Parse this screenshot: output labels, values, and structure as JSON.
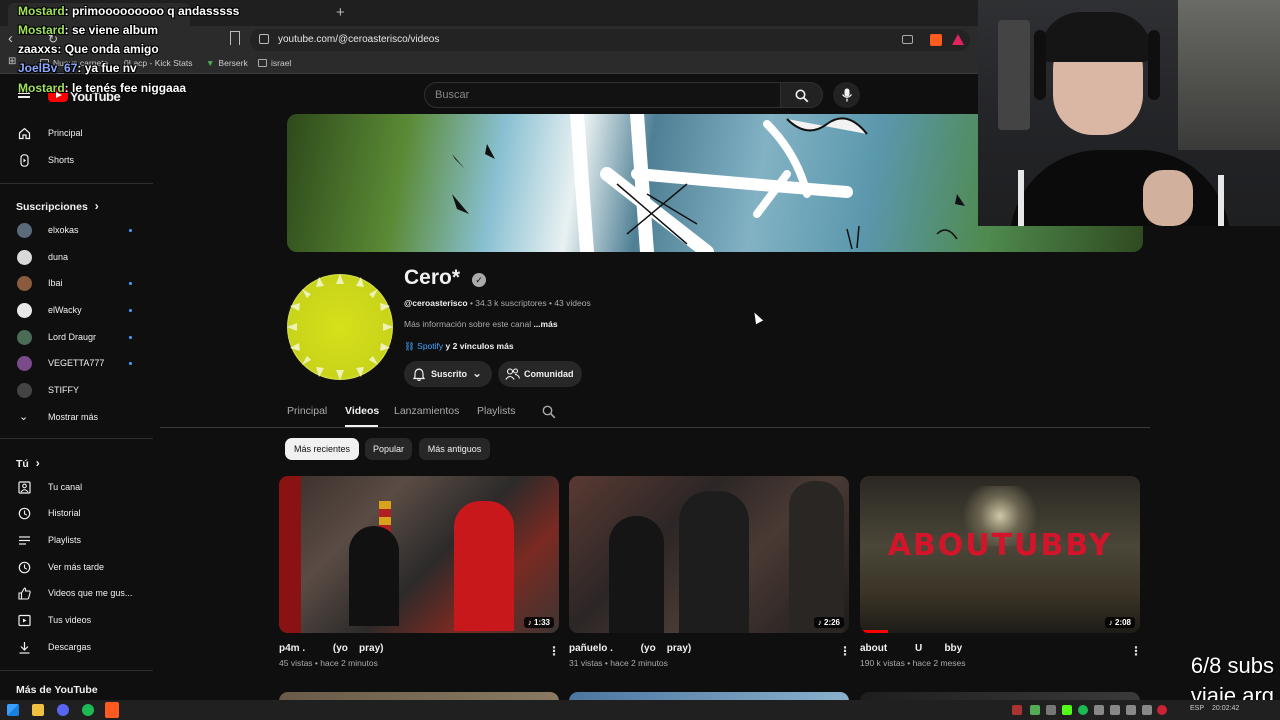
{
  "browser": {
    "url": "youtube.com/@ceroasterisco/videos",
    "new_tab_glyph": "+",
    "bookmarks": [
      "Nueva carpeta",
      "0Lacp - Kick Stats",
      "Berserk",
      "israel"
    ]
  },
  "header": {
    "logo_text": "YouTube",
    "search_placeholder": "Buscar"
  },
  "sidebar": {
    "main": [
      {
        "label": "Principal",
        "icon": "home-icon"
      },
      {
        "label": "Shorts",
        "icon": "shorts-icon"
      }
    ],
    "subscriptions_heading": "Suscripciones",
    "subscriptions": [
      {
        "label": "elxokas",
        "dot": true
      },
      {
        "label": "duna",
        "dot": false
      },
      {
        "label": "Ibai",
        "dot": true
      },
      {
        "label": "elWacky",
        "dot": true
      },
      {
        "label": "Lord Draugr",
        "dot": true
      },
      {
        "label": "VEGETTA777",
        "dot": true
      },
      {
        "label": "STIFFY",
        "dot": false
      }
    ],
    "show_more": "Mostrar más",
    "you_heading": "Tú",
    "you_items": [
      {
        "label": "Tu canal",
        "icon": "channel-icon"
      },
      {
        "label": "Historial",
        "icon": "history-icon"
      },
      {
        "label": "Playlists",
        "icon": "playlists-icon"
      },
      {
        "label": "Ver más tarde",
        "icon": "watch-later-icon"
      },
      {
        "label": "Videos que me gus...",
        "icon": "like-icon"
      },
      {
        "label": "Tus videos",
        "icon": "your-videos-icon"
      },
      {
        "label": "Descargas",
        "icon": "download-icon"
      }
    ],
    "more_heading": "Más de YouTube"
  },
  "channel": {
    "name": "Cero*",
    "verified_glyph": "✓",
    "handle": "@ceroasterisco",
    "stats": " • 34.3 k suscriptores • 43 videos",
    "description": "Más información sobre este canal ",
    "more": "...más",
    "link_spotify": "Spotify",
    "link_extra": " y 2 vínculos más",
    "subscribed_label": "Suscrito",
    "community_label": "Comunidad",
    "tabs": [
      "Principal",
      "Videos",
      "Lanzamientos",
      "Playlists"
    ],
    "active_tab": "Videos",
    "filters": [
      "Más recientes",
      "Popular",
      "Más antiguos"
    ],
    "active_filter": "Más recientes"
  },
  "videos": [
    {
      "title": "p4m .          (yo    pray)",
      "meta": "45 vistas • hace 2 minutos",
      "duration": "♪ 1:33"
    },
    {
      "title": "pañuelo .          (yo    pray)",
      "meta": "31 vistas • hace 2 minutos",
      "duration": "♪ 2:26"
    },
    {
      "title": "about          U        bby",
      "meta": "190 k vistas • hace 2 meses",
      "duration": "♪ 2:08"
    }
  ],
  "thumb_overlay_text": "ABOUTUBBY",
  "chat": [
    {
      "user": "Mostard",
      "msg": ": primooooooooo q andasssss"
    },
    {
      "user": "Mostard",
      "msg": ": se viene album"
    },
    {
      "user": "",
      "msg": "zaaxxs: Que onda amigo"
    },
    {
      "user": "JoelBv_67",
      "msg": ": ya fue nv"
    },
    {
      "user": "Mostard",
      "msg": ": le tenés fee niggaaa"
    }
  ],
  "stream_overlay": {
    "line1": "6/8 subs",
    "line2": "viaje arg"
  },
  "taskbar": {
    "lang": "ESP",
    "time": "20:02:42"
  },
  "colors": {
    "background": "#0f0f0f",
    "accent_blue": "#3ea6ff",
    "yt_red": "#ff0000",
    "avatar_yellow": "#c8d41a",
    "chat_user_green": "#9fe25a"
  }
}
